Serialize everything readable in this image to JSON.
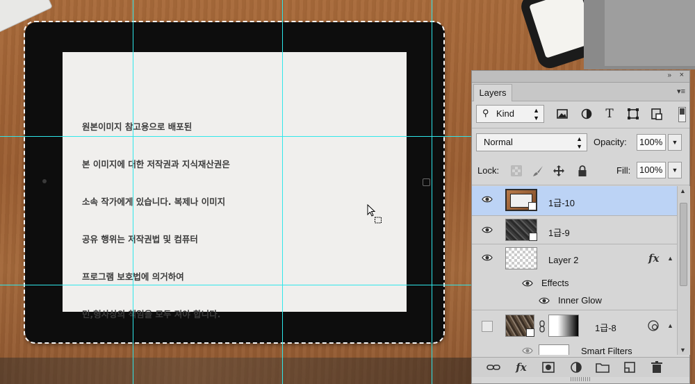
{
  "canvas": {
    "notice_lines": [
      "원본이미지 참고용으로 배포된",
      "본 이미지에 대한 저작권과 지식재산권은",
      "소속 작가에게 있습니다. 복제나 이미지",
      "공유 행위는 저작권법 및 컴퓨터",
      "프로그램 보호법에 의거하여",
      "민,형사상의 책임을 모두 져야 합니다."
    ],
    "guide_color": "#2fe7ea"
  },
  "panel": {
    "collapse_icon": "»",
    "close_icon": "×",
    "tab_label": "Layers",
    "menu_icon": "≡",
    "filter": {
      "kind_label": "Kind",
      "icons": [
        "image-filter-icon",
        "adjustment-filter-icon",
        "type-filter-icon",
        "shape-filter-icon",
        "smart-object-filter-icon"
      ]
    },
    "blend_mode": "Normal",
    "opacity_label": "Opacity:",
    "opacity_value": "100%",
    "lock_label": "Lock:",
    "fill_label": "Fill:",
    "fill_value": "100%",
    "layers": [
      {
        "name": "1급-10",
        "selected": true,
        "visible": true
      },
      {
        "name": "1급-9",
        "selected": false,
        "visible": true
      },
      {
        "name": "Layer 2",
        "selected": false,
        "visible": true,
        "fx": "fx"
      },
      {
        "name": "Effects",
        "type": "effects-group"
      },
      {
        "name": "Inner Glow",
        "type": "effect"
      },
      {
        "name": "1급-8",
        "selected": false,
        "visible": false
      },
      {
        "name": "Smart Filters",
        "type": "smart-filters"
      }
    ],
    "bottom_icons": [
      "link-layers-icon",
      "fx-icon",
      "layer-mask-icon",
      "adjustment-layer-icon",
      "group-folder-icon",
      "new-layer-icon",
      "trash-icon"
    ]
  }
}
